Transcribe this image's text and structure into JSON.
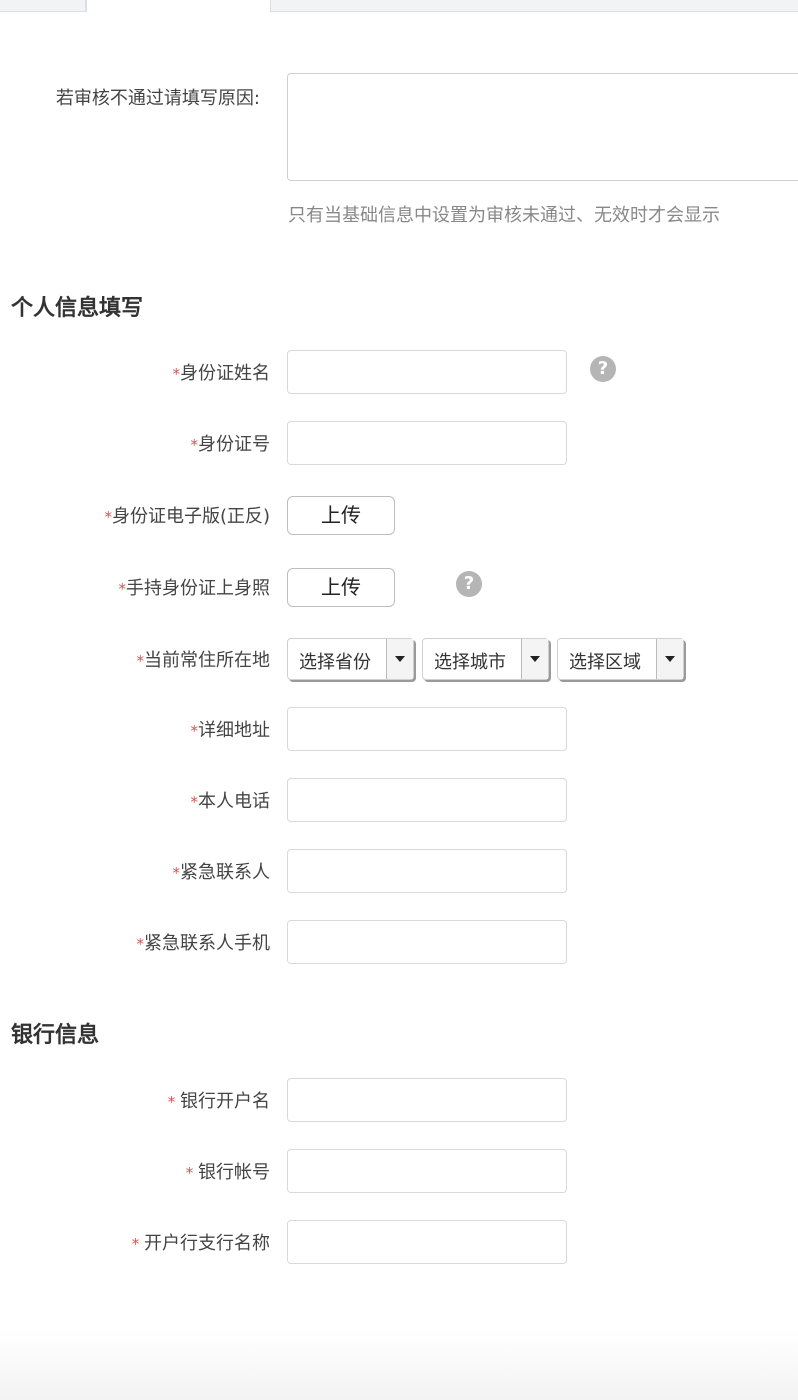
{
  "review": {
    "reason_label": "若审核不通过请填写原因:",
    "hint": "只有当基础信息中设置为审核未通过、无效时才会显示"
  },
  "personal": {
    "title": "个人信息填写",
    "required_mark": "*",
    "id_name_label": "身份证姓名",
    "id_number_label": "身份证号",
    "id_scan_label": "身份证电子版(正反)",
    "id_scan_button": "上传",
    "id_holding_label": "手持身份证上身照",
    "id_holding_button": "上传",
    "residence_label": "当前常住所在地",
    "province_select": "选择省份",
    "city_select": "选择城市",
    "district_select": "选择区域",
    "address_label": "详细地址",
    "phone_label": "本人电话",
    "emergency_contact_label": "紧急联系人",
    "emergency_phone_label": "紧急联系人手机",
    "help_glyph": "?"
  },
  "bank": {
    "title": "银行信息",
    "required_mark": "* ",
    "account_name_label": "银行开户名",
    "account_number_label": "银行帐号",
    "branch_label": "开户行支行名称"
  }
}
